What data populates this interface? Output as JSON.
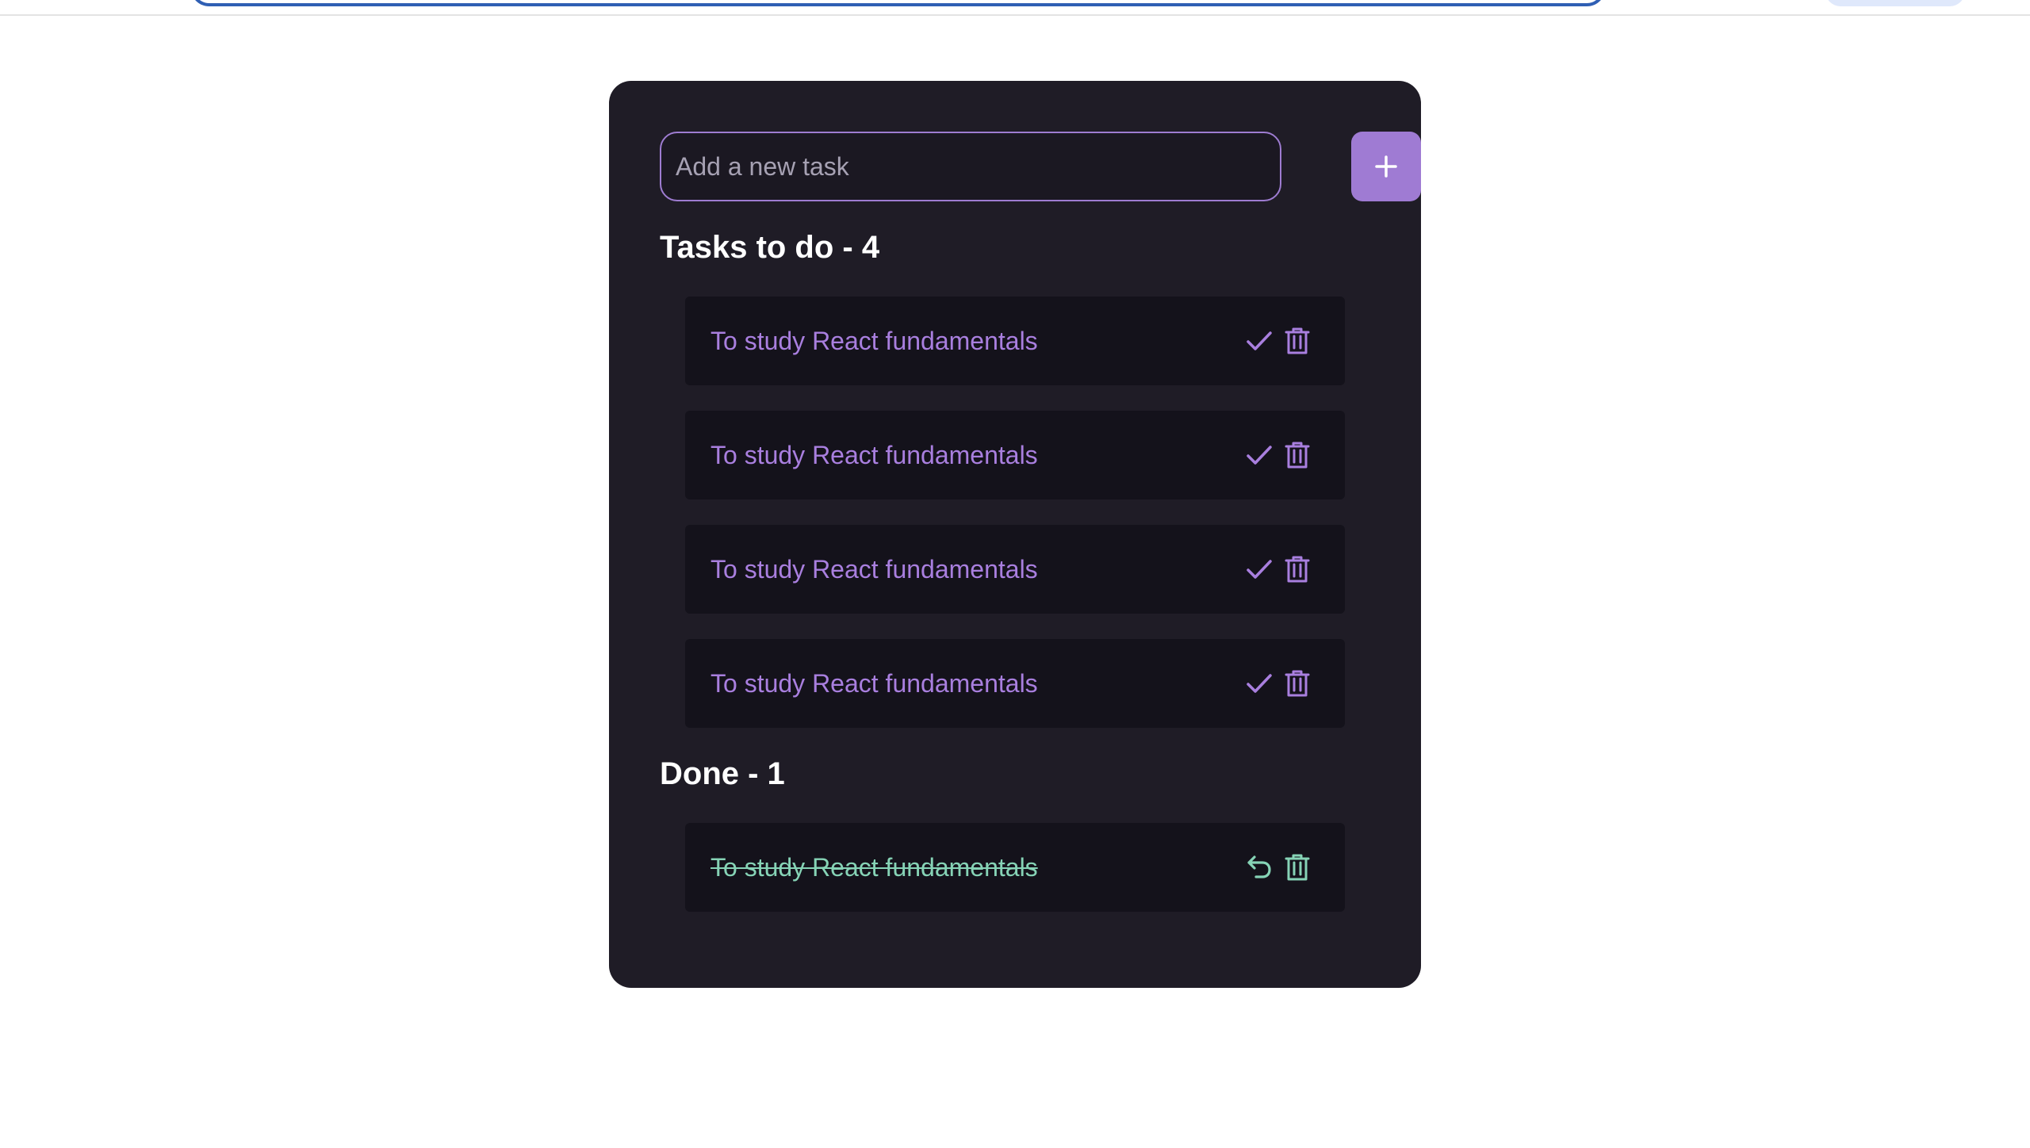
{
  "new_task": {
    "placeholder": "Add a new task",
    "value": ""
  },
  "todo": {
    "heading": "Tasks to do - 4",
    "items": [
      {
        "label": "To study React fundamentals"
      },
      {
        "label": "To study React fundamentals"
      },
      {
        "label": "To study React fundamentals"
      },
      {
        "label": "To study React fundamentals"
      }
    ]
  },
  "done": {
    "heading": "Done - 1",
    "items": [
      {
        "label": "To study React fundamentals"
      }
    ]
  },
  "icons": {
    "add": "plus-icon",
    "complete": "check-icon",
    "delete": "trash-icon",
    "undo": "undo-icon"
  },
  "colors": {
    "page_background": "#ffffff",
    "card_background": "#1f1c26",
    "task_background": "#14121b",
    "accent_purple": "#9f7bd3",
    "todo_text": "#a97fdf",
    "done_text": "#86d3b6",
    "heading_text": "#ffffff"
  }
}
